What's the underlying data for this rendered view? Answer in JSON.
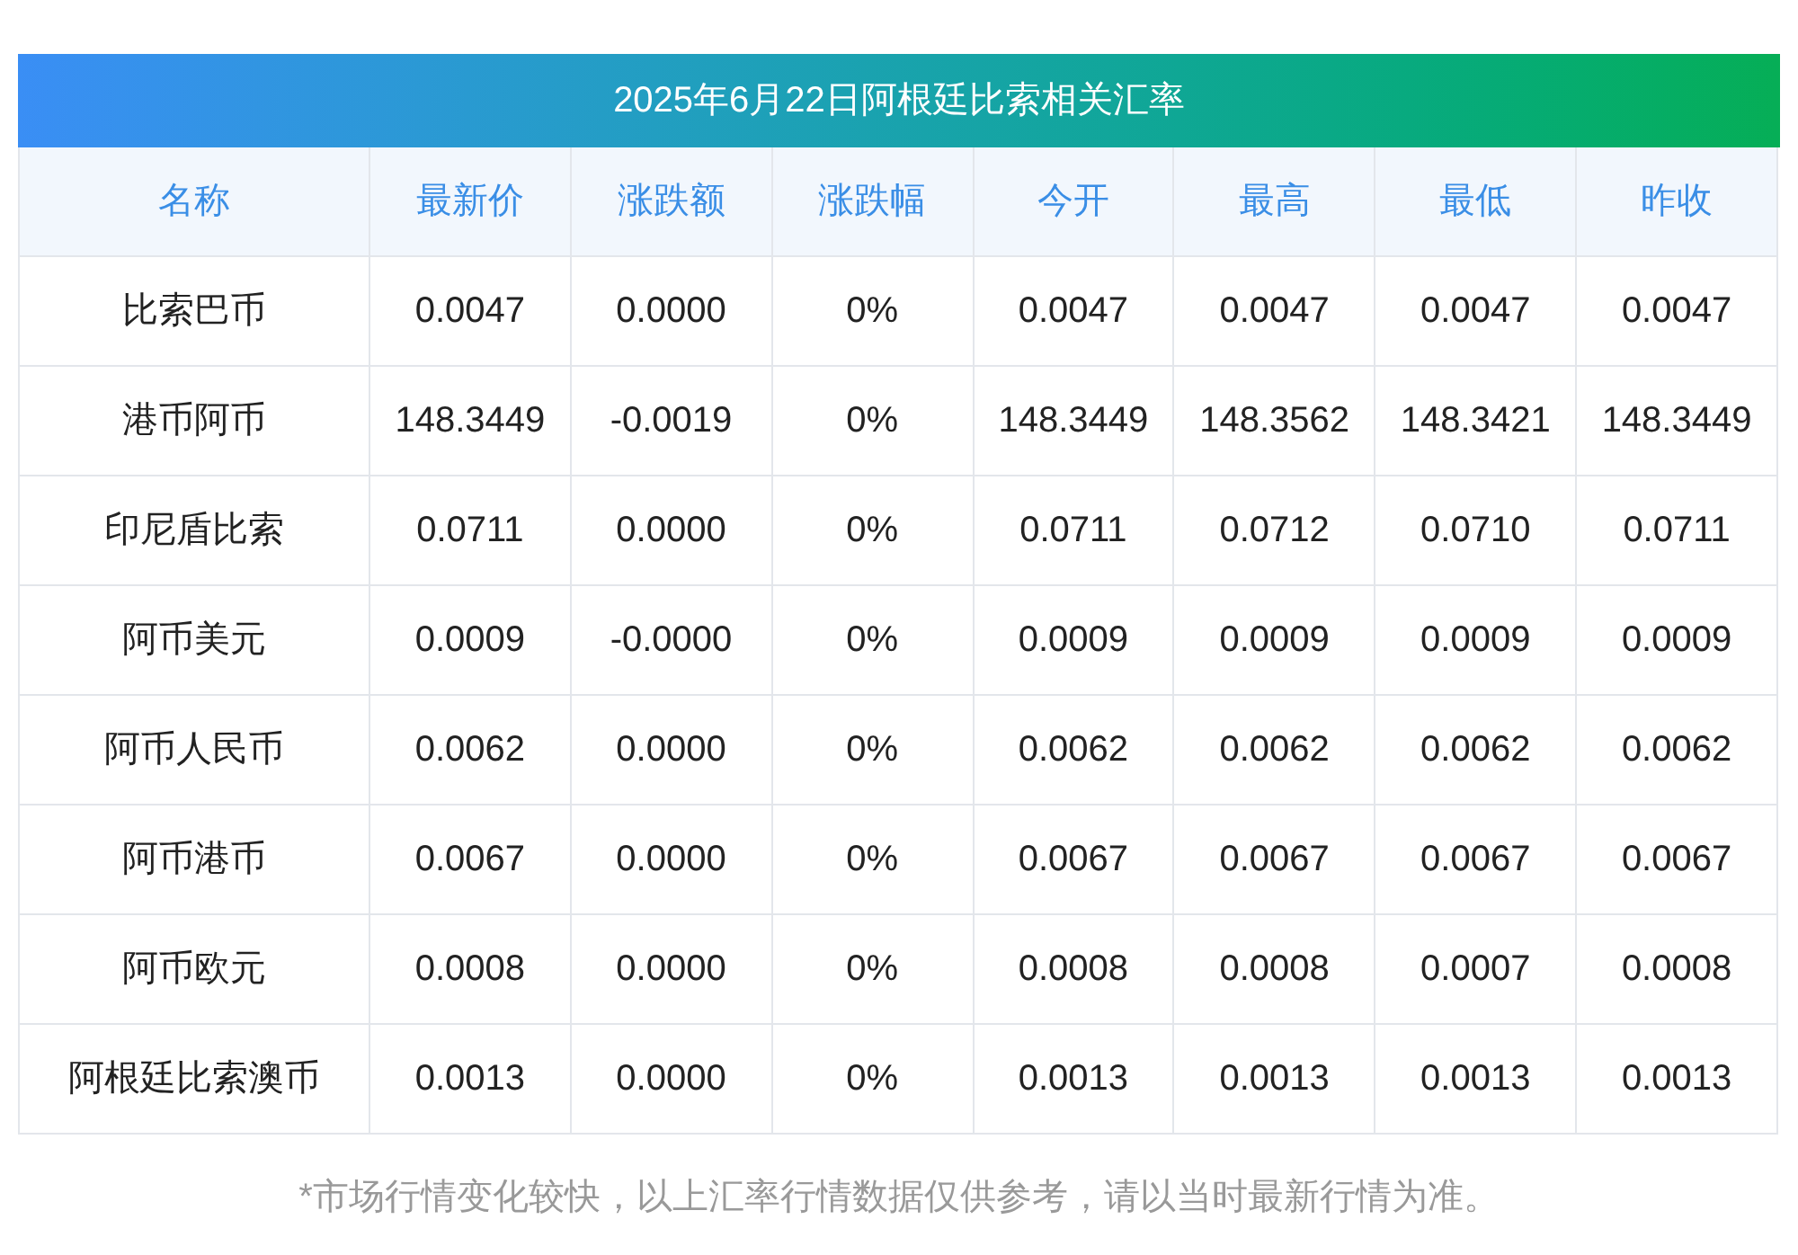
{
  "title": "2025年6月22日阿根廷比索相关汇率",
  "columns": [
    "名称",
    "最新价",
    "涨跌额",
    "涨跌幅",
    "今开",
    "最高",
    "最低",
    "昨收"
  ],
  "rows": [
    [
      "比索巴币",
      "0.0047",
      "0.0000",
      "0%",
      "0.0047",
      "0.0047",
      "0.0047",
      "0.0047"
    ],
    [
      "港币阿币",
      "148.3449",
      "-0.0019",
      "0%",
      "148.3449",
      "148.3562",
      "148.3421",
      "148.3449"
    ],
    [
      "印尼盾比索",
      "0.0711",
      "0.0000",
      "0%",
      "0.0711",
      "0.0712",
      "0.0710",
      "0.0711"
    ],
    [
      "阿币美元",
      "0.0009",
      "-0.0000",
      "0%",
      "0.0009",
      "0.0009",
      "0.0009",
      "0.0009"
    ],
    [
      "阿币人民币",
      "0.0062",
      "0.0000",
      "0%",
      "0.0062",
      "0.0062",
      "0.0062",
      "0.0062"
    ],
    [
      "阿币港币",
      "0.0067",
      "0.0000",
      "0%",
      "0.0067",
      "0.0067",
      "0.0067",
      "0.0067"
    ],
    [
      "阿币欧元",
      "0.0008",
      "0.0000",
      "0%",
      "0.0008",
      "0.0008",
      "0.0007",
      "0.0008"
    ],
    [
      "阿根廷比索澳币",
      "0.0013",
      "0.0000",
      "0%",
      "0.0013",
      "0.0013",
      "0.0013",
      "0.0013"
    ]
  ],
  "footnote": "*市场行情变化较快，以上汇率行情数据仅供参考，请以当时最新行情为准。"
}
